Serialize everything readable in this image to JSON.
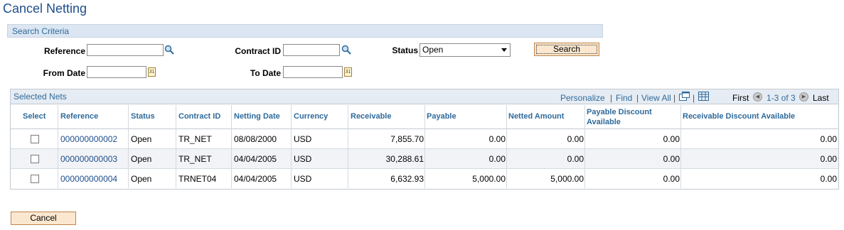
{
  "page": {
    "title": "Cancel Netting"
  },
  "search": {
    "section_title": "Search Criteria",
    "reference_label": "Reference",
    "reference_value": "",
    "contract_id_label": "Contract ID",
    "contract_id_value": "",
    "status_label": "Status",
    "status_value": "Open",
    "from_date_label": "From Date",
    "from_date_value": "",
    "to_date_label": "To Date",
    "to_date_value": "",
    "search_button": "Search"
  },
  "grid": {
    "title": "Selected Nets",
    "personalize": "Personalize",
    "find": "Find",
    "view_all": "View All",
    "first": "First",
    "range": "1-3 of 3",
    "last": "Last",
    "sep": "|",
    "columns": {
      "select": "Select",
      "reference": "Reference",
      "status": "Status",
      "contract_id": "Contract ID",
      "netting_date": "Netting Date",
      "currency": "Currency",
      "receivable": "Receivable",
      "payable": "Payable",
      "netted_amount": "Netted Amount",
      "payable_discount": "Payable Discount Available",
      "receivable_discount": "Receivable Discount Available"
    },
    "rows": [
      {
        "reference": "000000000002",
        "status": "Open",
        "contract_id": "TR_NET",
        "netting_date": "08/08/2000",
        "currency": "USD",
        "receivable": "7,855.70",
        "payable": "0.00",
        "netted_amount": "0.00",
        "payable_discount": "0.00",
        "receivable_discount": "0.00"
      },
      {
        "reference": "000000000003",
        "status": "Open",
        "contract_id": "TR_NET",
        "netting_date": "04/04/2005",
        "currency": "USD",
        "receivable": "30,288.61",
        "payable": "0.00",
        "netted_amount": "0.00",
        "payable_discount": "0.00",
        "receivable_discount": "0.00"
      },
      {
        "reference": "000000000004",
        "status": "Open",
        "contract_id": "TRNET04",
        "netting_date": "04/04/2005",
        "currency": "USD",
        "receivable": "6,632.93",
        "payable": "5,000.00",
        "netted_amount": "5,000.00",
        "payable_discount": "0.00",
        "receivable_discount": "0.00"
      }
    ]
  },
  "footer": {
    "cancel_button": "Cancel"
  },
  "icons": {
    "lookup": "magnifier-icon",
    "calendar": "calendar-icon",
    "calendar_text": "31"
  }
}
